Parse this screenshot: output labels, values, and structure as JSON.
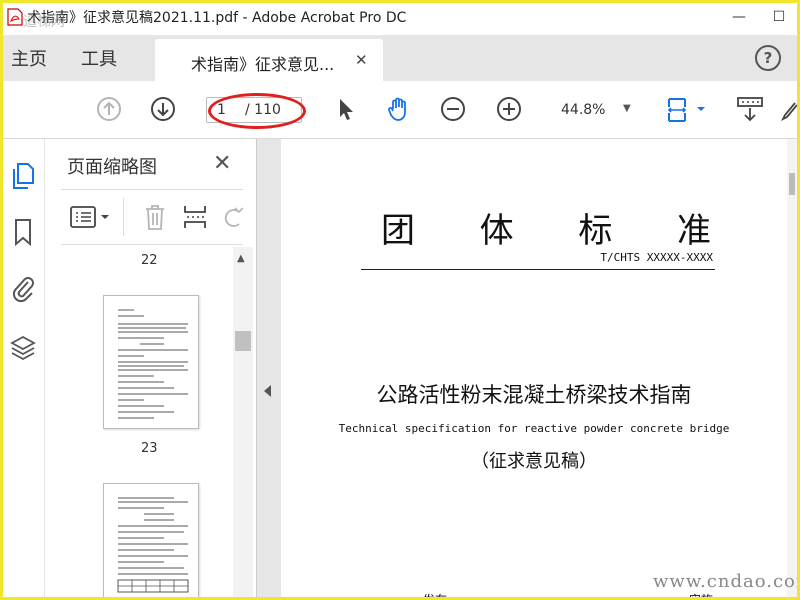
{
  "window": {
    "title": "术指南》征求意见稿2021.11.pdf - Adobe Acrobat Pro DC",
    "watermark": "追梯网",
    "minimize": "—",
    "maximize": "☐"
  },
  "tabs": {
    "home": "主页",
    "tools": "工具",
    "document": "术指南》征求意见...",
    "close": "✕",
    "help": "?"
  },
  "toolbar": {
    "page_current": "1",
    "page_total": "/ 110",
    "zoom": "44.8%",
    "accent_color": "#1473e6",
    "highlight_color": "#e01f1f"
  },
  "thumbnails": {
    "title": "页面缩略图",
    "close": "✕",
    "pages": [
      "22",
      "23"
    ]
  },
  "document": {
    "standard_chars": [
      "团",
      "体",
      "标",
      "准"
    ],
    "code": "T/CHTS XXXXX-XXXX",
    "title_cn": "公路活性粉末混凝土桥梁技术指南",
    "title_en": "Technical specification for reactive powder concrete bridge",
    "draft_label": "（征求意见稿）",
    "footer_left": "发布",
    "footer_right": "实施"
  },
  "watermark_site": "www.cndao.com"
}
